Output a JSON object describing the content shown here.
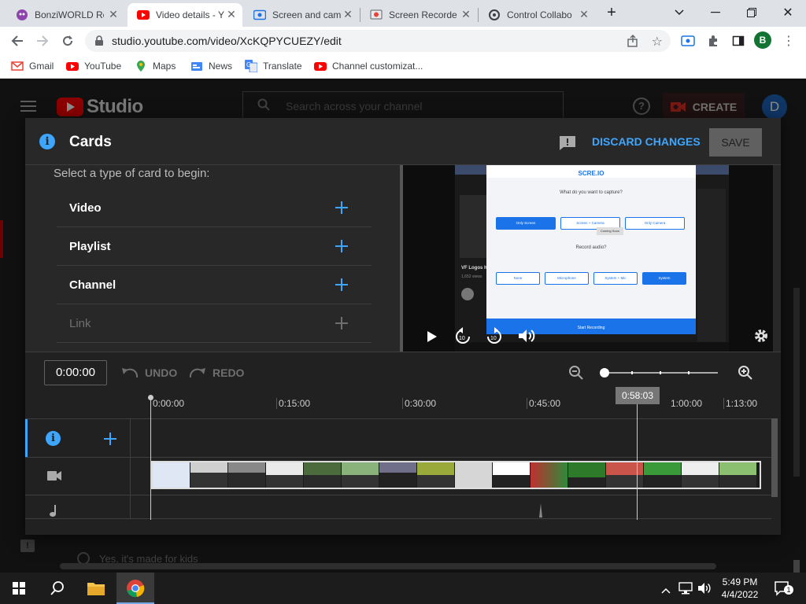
{
  "browser": {
    "tabs": [
      {
        "title": "BonziWORLD Re",
        "active": false
      },
      {
        "title": "Video details - Y",
        "active": true
      },
      {
        "title": "Screen and cam",
        "active": false
      },
      {
        "title": "Screen Recorde",
        "active": false
      },
      {
        "title": "Control Collabo",
        "active": false
      }
    ],
    "url": "studio.youtube.com/video/XcKQPYCUEZY/edit",
    "profile_initial": "B",
    "bookmarks": [
      "Gmail",
      "YouTube",
      "Maps",
      "News",
      "Translate",
      "Channel customizat..."
    ]
  },
  "studio": {
    "logo_text": "Studio",
    "search_placeholder": "Search across your channel",
    "create_label": "CREATE",
    "avatar_initial": "D",
    "bottom_hint": "Yes, it's made for kids"
  },
  "dialog": {
    "title": "Cards",
    "discard_label": "DISCARD CHANGES",
    "save_label": "SAVE",
    "prompt": "Select a type of card to begin:",
    "card_types": [
      {
        "label": "Video",
        "enabled": true
      },
      {
        "label": "Playlist",
        "enabled": true
      },
      {
        "label": "Channel",
        "enabled": true
      },
      {
        "label": "Link",
        "enabled": false
      }
    ]
  },
  "preview_screen": {
    "brand": "SCRE.IO",
    "capture_question": "What do you want to capture?",
    "capture_options": [
      "Only Screen",
      "Screen + Camera",
      "Only Camera"
    ],
    "tooltip": "Coming Soon",
    "audio_question": "Record audio?",
    "audio_options": [
      "None",
      "Microphone",
      "System + Mic",
      "System"
    ],
    "start_label": "Start Recording",
    "video_title": "VF Logos h",
    "views": "1,652 views"
  },
  "timeline": {
    "current_time": "0:00:00",
    "undo_label": "UNDO",
    "redo_label": "REDO",
    "playhead_time": "0:58:03",
    "ticks": [
      "0:00:00",
      "0:15:00",
      "0:30:00",
      "0:45:00",
      "1:00:00",
      "1:13:00"
    ],
    "zoom_level": 0
  },
  "taskbar": {
    "time": "5:49 PM",
    "date": "4/4/2022",
    "notification_count": "1"
  },
  "colors": {
    "accent_blue": "#3ea6ff",
    "yt_red": "#ff0000",
    "dialog_bg": "#282828"
  }
}
